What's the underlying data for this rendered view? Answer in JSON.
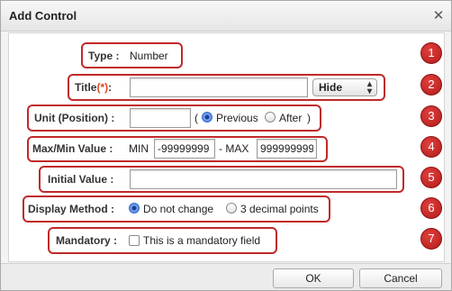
{
  "dialog": {
    "title": "Add Control",
    "close_glyph": "✕",
    "ok_label": "OK",
    "cancel_label": "Cancel"
  },
  "fields": {
    "type": {
      "label": "Type :",
      "value": "Number"
    },
    "title": {
      "label": "Title",
      "required_mark": "(*)",
      "colon": ":",
      "value": "",
      "visibility_option": "Hide"
    },
    "unit": {
      "label": "Unit (Position) :",
      "value": "",
      "open_paren": "(",
      "close_paren": ")",
      "options": [
        "Previous",
        "After"
      ],
      "selected": "Previous"
    },
    "maxmin": {
      "label": "Max/Min Value :",
      "min_label": "MIN",
      "min_value": "-99999999",
      "sep_label": "- MAX",
      "max_value": "999999999"
    },
    "initial": {
      "label": "Initial Value :",
      "value": ""
    },
    "display": {
      "label": "Display Method :",
      "options": [
        "Do not change",
        "3 decimal points"
      ],
      "selected": "Do not change"
    },
    "mandatory": {
      "label": "Mandatory :",
      "checkbox_label": "This is a mandatory field",
      "checked": false
    }
  },
  "callouts": [
    "1",
    "2",
    "3",
    "4",
    "5",
    "6",
    "7"
  ],
  "colors": {
    "callout": "#c0292a",
    "required": "#e04a1f"
  },
  "icons": {
    "close": "close-icon",
    "select_arrow": "chevron-updown-icon"
  }
}
